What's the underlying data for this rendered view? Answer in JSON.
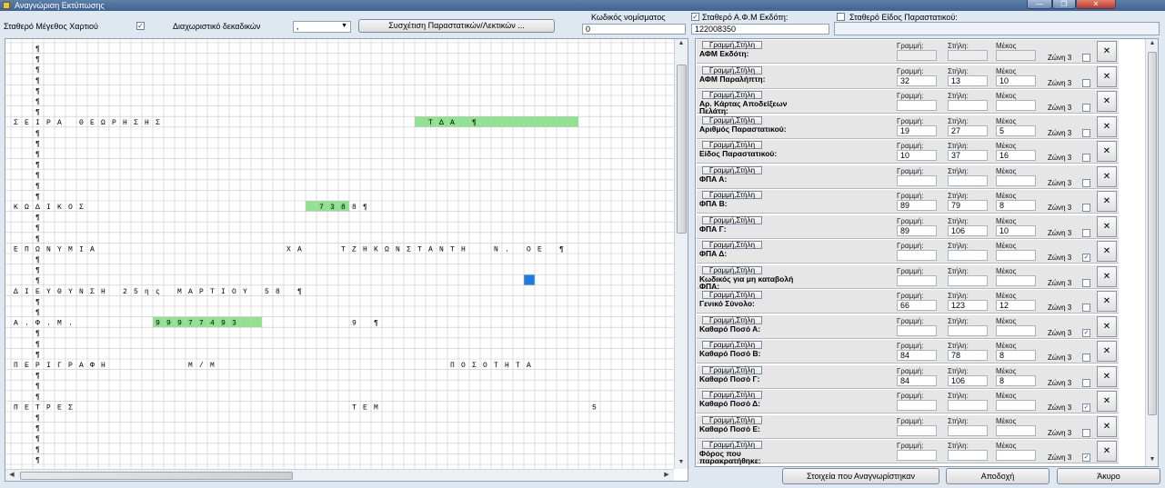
{
  "window": {
    "title": "Αναγνώριση Εκτύπωσης",
    "min_glyph": "—",
    "max_glyph": "❐",
    "close_glyph": "✕"
  },
  "toolbar": {
    "paper_size_label": "Σταθερό Μέγεθος Χαρτιού",
    "paper_size_checked": true,
    "decimal_sep_label": "Διαχωριστικό δεκαδικών",
    "decimal_sep_value": ",",
    "mapping_button": "Συσχέτιση Παραστατικών/Λεκτικών ...",
    "currency_label": "Κωδικός νομίσματος",
    "currency_value": "0",
    "fixed_afm_label": "Σταθερό Α.Φ.Μ Εκδότη:",
    "fixed_afm_checked": true,
    "fixed_afm_value": "122008350",
    "fixed_doc_type_label": "Σταθερό Είδος Παραστατικού:",
    "fixed_doc_type_checked": false
  },
  "print_grid": {
    "paragraph_mark": "¶",
    "rows": [
      {
        "row": 7,
        "text": "ΣΕΙΡΑ ΘΕΩΡΗΣΗΣ",
        "col": 0
      },
      {
        "row": 7,
        "text": "ΤΔΑ ¶",
        "col": 38,
        "highlight": [
          37,
          52
        ]
      },
      {
        "row": 15,
        "text": "ΚΩΔΙΚΟΣ",
        "col": 0
      },
      {
        "row": 15,
        "text": "7388",
        "col": 28,
        "highlight": [
          27,
          31
        ]
      },
      {
        "row": 15,
        "text": "¶",
        "col": 32
      },
      {
        "row": 19,
        "text": "ΕΠΩΝΥΜΙΑ",
        "col": 0
      },
      {
        "row": 19,
        "text": "ΧΑ",
        "col": 25
      },
      {
        "row": 19,
        "text": "ΤΖΗΚΩΝΣΤΑΝΤΗ",
        "col": 30
      },
      {
        "row": 19,
        "text": "Ν. ΟΕ ¶",
        "col": 44
      },
      {
        "row": 23,
        "text": "ΔΙΕΥΘΥΝΣΗ 25ης ΜΑΡΤΙΟΥ 58 ¶",
        "col": 0
      },
      {
        "row": 26,
        "text": "Α.Φ.Μ.",
        "col": 0
      },
      {
        "row": 26,
        "text": "99977493",
        "col": 13,
        "highlight": [
          13,
          23
        ]
      },
      {
        "row": 26,
        "text": "9 ¶",
        "col": 31
      },
      {
        "row": 30,
        "text": "ΠΕΡΙΓΡΑΦΗ",
        "col": 0
      },
      {
        "row": 30,
        "text": "Μ/Μ",
        "col": 16
      },
      {
        "row": 30,
        "text": "ΠΟΣΟΤΗΤΑ",
        "col": 40
      },
      {
        "row": 34,
        "text": "ΠΕΤΡΕΣ",
        "col": 0
      },
      {
        "row": 34,
        "text": "ΤΕΜ",
        "col": 31
      },
      {
        "row": 34,
        "text": "5",
        "col": 53
      }
    ],
    "cursor": {
      "row": 22,
      "col": 47
    }
  },
  "fields_header": {
    "rowcol_button": "Γραμμή,Στήλη",
    "line": "Γραμμή:",
    "column": "Στήλη:",
    "length": "Μέκος",
    "zone": "Ζώνη 3",
    "delete": "✕"
  },
  "fields": [
    {
      "name": "ΑΦΜ Εκδότη:",
      "line": "",
      "column": "",
      "length": "",
      "zone_checked": false,
      "disabled": true
    },
    {
      "name": "ΑΦΜ Παραλήπτη:",
      "line": "32",
      "column": "13",
      "length": "10",
      "zone_checked": false
    },
    {
      "name": "Αρ. Κάρτας Αποδείξεων Πελάτη:",
      "line": "",
      "column": "",
      "length": "",
      "zone_checked": false
    },
    {
      "name": "Αριθμός Παραστατικού:",
      "line": "19",
      "column": "27",
      "length": "5",
      "zone_checked": false
    },
    {
      "name": "Είδος Παραστατικού:",
      "line": "10",
      "column": "37",
      "length": "16",
      "zone_checked": false
    },
    {
      "name": "ΦΠΑ Α:",
      "line": "",
      "column": "",
      "length": "",
      "zone_checked": false
    },
    {
      "name": "ΦΠΑ Β:",
      "line": "89",
      "column": "79",
      "length": "8",
      "zone_checked": false
    },
    {
      "name": "ΦΠΑ Γ:",
      "line": "89",
      "column": "106",
      "length": "10",
      "zone_checked": false
    },
    {
      "name": "ΦΠΑ Δ:",
      "line": "",
      "column": "",
      "length": "",
      "zone_checked": true
    },
    {
      "name": "Κωδικός για μη καταβολή ΦΠΑ:",
      "line": "",
      "column": "",
      "length": "",
      "zone_checked": false
    },
    {
      "name": "Γενικό Σύνολο:",
      "line": "66",
      "column": "123",
      "length": "12",
      "zone_checked": false
    },
    {
      "name": "Καθαρό Ποσό Α:",
      "line": "",
      "column": "",
      "length": "",
      "zone_checked": true
    },
    {
      "name": "Καθαρό Ποσό Β:",
      "line": "84",
      "column": "78",
      "length": "8",
      "zone_checked": false
    },
    {
      "name": "Καθαρό Ποσό Γ:",
      "line": "84",
      "column": "106",
      "length": "8",
      "zone_checked": false
    },
    {
      "name": "Καθαρό Ποσό Δ:",
      "line": "",
      "column": "",
      "length": "",
      "zone_checked": true
    },
    {
      "name": "Καθαρό Ποσό Ε:",
      "line": "",
      "column": "",
      "length": "",
      "zone_checked": false
    },
    {
      "name": "Φόρος που παρακρατήθηκε:",
      "line": "",
      "column": "",
      "length": "",
      "zone_checked": true
    }
  ],
  "footer": {
    "recognized_button": "Στοιχεία που Αναγνωρίστηκαν",
    "accept_button": "Αποδοχή",
    "cancel_button": "Άκυρο"
  },
  "colors": {
    "highlight": "#8fe38f",
    "cursor": "#1e7be0",
    "grid": "#c8c8c8"
  }
}
